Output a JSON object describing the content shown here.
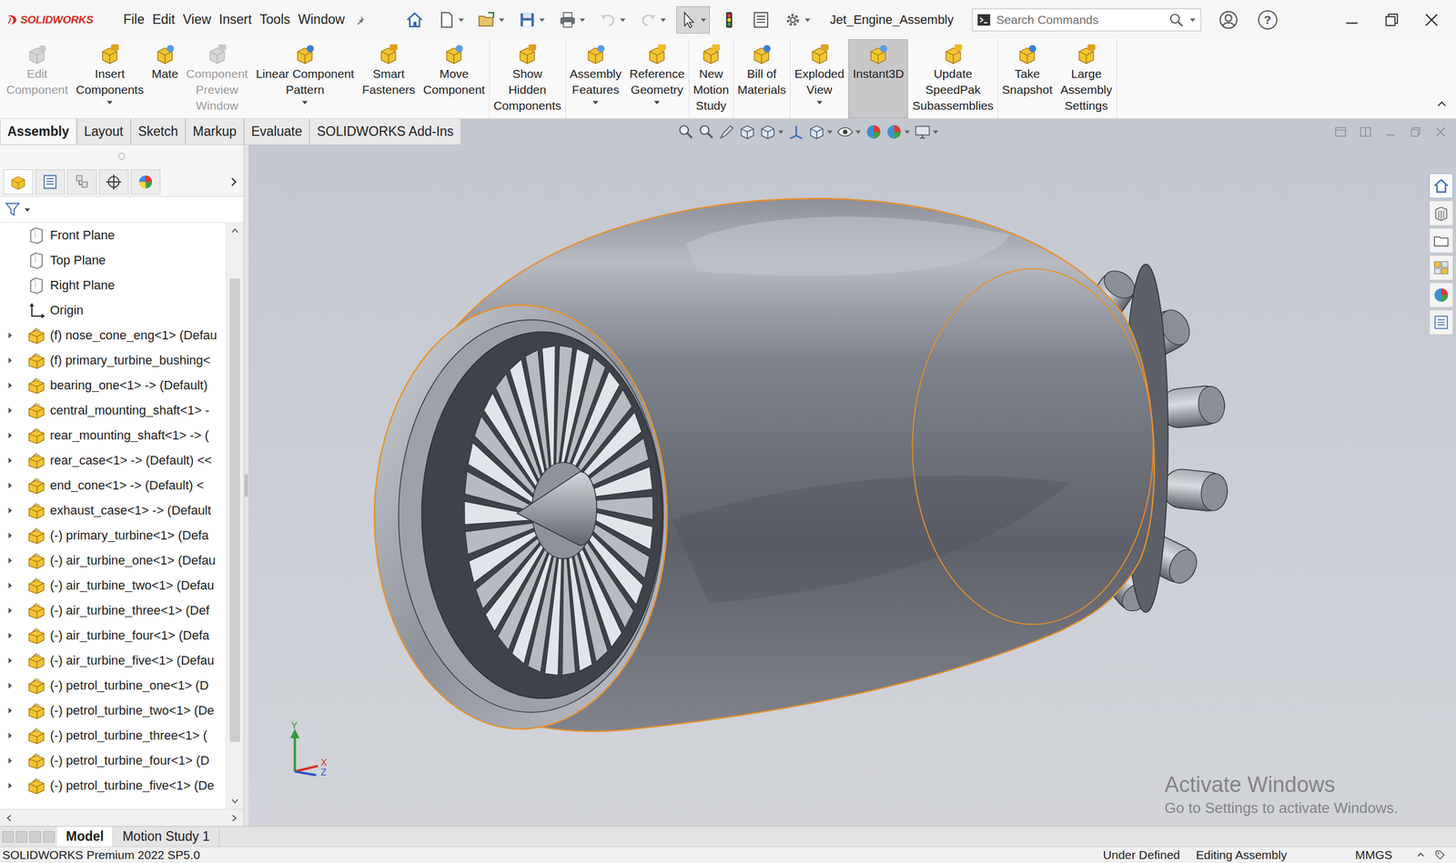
{
  "window": {
    "title": "Jet_Engine_Assembly"
  },
  "app": {
    "logo": "SOLIDWORKS"
  },
  "menu": [
    "File",
    "Edit",
    "View",
    "Insert",
    "Tools",
    "Window"
  ],
  "quick_access": [
    {
      "dropdown": false,
      "selected": false,
      "disabled": false
    },
    {
      "dropdown": true,
      "selected": false,
      "disabled": false
    },
    {
      "dropdown": true,
      "selected": false,
      "disabled": false
    },
    {
      "dropdown": true,
      "selected": false,
      "disabled": false
    },
    {
      "dropdown": true,
      "selected": false,
      "disabled": false
    },
    {
      "dropdown": true,
      "selected": false,
      "disabled": true
    },
    {
      "dropdown": true,
      "selected": false,
      "disabled": true
    },
    {
      "dropdown": true,
      "selected": true,
      "disabled": false
    },
    {
      "dropdown": false,
      "selected": false,
      "disabled": false
    },
    {
      "dropdown": false,
      "selected": false,
      "disabled": false
    },
    {
      "dropdown": true,
      "selected": false,
      "disabled": false
    }
  ],
  "search": {
    "placeholder": "Search Commands"
  },
  "help": "?",
  "ribbon": {
    "groups": [
      [
        {
          "lines": [
            "Edit",
            "Component"
          ],
          "disabled": true,
          "selected": false,
          "dropdown": false
        },
        {
          "lines": [
            "Insert",
            "Components"
          ],
          "disabled": false,
          "selected": false,
          "dropdown": true
        },
        {
          "lines": [
            "Mate"
          ],
          "disabled": false,
          "selected": false,
          "dropdown": false
        },
        {
          "lines": [
            "Component",
            "Preview",
            "Window"
          ],
          "disabled": true,
          "selected": false,
          "dropdown": false
        },
        {
          "lines": [
            "Linear Component",
            "Pattern"
          ],
          "disabled": false,
          "selected": false,
          "dropdown": true
        },
        {
          "lines": [
            "Smart",
            "Fasteners"
          ],
          "disabled": false,
          "selected": false,
          "dropdown": false
        },
        {
          "lines": [
            "Move",
            "Component"
          ],
          "disabled": false,
          "selected": false,
          "dropdown": false
        }
      ],
      [
        {
          "lines": [
            "Show",
            "Hidden",
            "Components"
          ],
          "disabled": false,
          "selected": false,
          "dropdown": false
        }
      ],
      [
        {
          "lines": [
            "Assembly",
            "Features"
          ],
          "disabled": false,
          "selected": false,
          "dropdown": true
        },
        {
          "lines": [
            "Reference",
            "Geometry"
          ],
          "disabled": false,
          "selected": false,
          "dropdown": true
        }
      ],
      [
        {
          "lines": [
            "New",
            "Motion",
            "Study"
          ],
          "disabled": false,
          "selected": false,
          "dropdown": false
        }
      ],
      [
        {
          "lines": [
            "Bill of",
            "Materials"
          ],
          "disabled": false,
          "selected": false,
          "dropdown": false
        }
      ],
      [
        {
          "lines": [
            "Exploded",
            "View"
          ],
          "disabled": false,
          "selected": false,
          "dropdown": true
        }
      ],
      [
        {
          "lines": [
            "Instant3D"
          ],
          "disabled": false,
          "selected": true,
          "dropdown": false
        }
      ],
      [
        {
          "lines": [
            "Update",
            "SpeedPak",
            "Subassemblies"
          ],
          "disabled": false,
          "selected": false,
          "dropdown": false
        }
      ],
      [
        {
          "lines": [
            "Take",
            "Snapshot"
          ],
          "disabled": false,
          "selected": false,
          "dropdown": false
        },
        {
          "lines": [
            "Large",
            "Assembly",
            "Settings"
          ],
          "disabled": false,
          "selected": false,
          "dropdown": false
        }
      ]
    ]
  },
  "tabs": [
    {
      "label": "Assembly",
      "selected": true
    },
    {
      "label": "Layout",
      "selected": false
    },
    {
      "label": "Sketch",
      "selected": false
    },
    {
      "label": "Markup",
      "selected": false
    },
    {
      "label": "Evaluate",
      "selected": false
    },
    {
      "label": "SOLIDWORKS Add-Ins",
      "selected": false
    }
  ],
  "tree": {
    "items": [
      {
        "label": "Front Plane",
        "kind": "plane",
        "expandable": false
      },
      {
        "label": "Top Plane",
        "kind": "plane",
        "expandable": false
      },
      {
        "label": "Right Plane",
        "kind": "plane",
        "expandable": false
      },
      {
        "label": "Origin",
        "kind": "origin",
        "expandable": false
      },
      {
        "label": "(f) nose_cone_eng<1> (Defau",
        "kind": "component",
        "expandable": true
      },
      {
        "label": "(f) primary_turbine_bushing<",
        "kind": "component",
        "expandable": true
      },
      {
        "label": "bearing_one<1> -> (Default)",
        "kind": "component",
        "expandable": true
      },
      {
        "label": "central_mounting_shaft<1> -",
        "kind": "component",
        "expandable": true
      },
      {
        "label": "rear_mounting_shaft<1> -> (",
        "kind": "component",
        "expandable": true
      },
      {
        "label": "rear_case<1> -> (Default) <<",
        "kind": "component",
        "expandable": true
      },
      {
        "label": "end_cone<1> -> (Default) <",
        "kind": "component",
        "expandable": true
      },
      {
        "label": "exhaust_case<1> -> (Default",
        "kind": "component",
        "expandable": true
      },
      {
        "label": "(-) primary_turbine<1> (Defa",
        "kind": "component",
        "expandable": true
      },
      {
        "label": "(-) air_turbine_one<1> (Defau",
        "kind": "component",
        "expandable": true
      },
      {
        "label": "(-) air_turbine_two<1> (Defau",
        "kind": "component",
        "expandable": true
      },
      {
        "label": "(-) air_turbine_three<1> (Def",
        "kind": "component",
        "expandable": true
      },
      {
        "label": "(-) air_turbine_four<1> (Defa",
        "kind": "component",
        "expandable": true
      },
      {
        "label": "(-) air_turbine_five<1> (Defau",
        "kind": "component",
        "expandable": true
      },
      {
        "label": "(-) petrol_turbine_one<1> (D",
        "kind": "component",
        "expandable": true
      },
      {
        "label": "(-) petrol_turbine_two<1> (De",
        "kind": "component",
        "expandable": true
      },
      {
        "label": "(-) petrol_turbine_three<1> (",
        "kind": "component",
        "expandable": true
      },
      {
        "label": "(-) petrol_turbine_four<1> (D",
        "kind": "component",
        "expandable": true
      },
      {
        "label": "(-) petrol_turbine_five<1> (De",
        "kind": "component",
        "expandable": true
      }
    ]
  },
  "triad": {
    "y": "Y",
    "x": "X",
    "z": "Z"
  },
  "watermark": {
    "title": "Activate Windows",
    "subtitle": "Go to Settings to activate Windows."
  },
  "bottom_tabs": [
    {
      "label": "Model",
      "selected": true
    },
    {
      "label": "Motion Study 1",
      "selected": false
    }
  ],
  "status_bar": {
    "product": "SOLIDWORKS Premium 2022 SP5.0",
    "state": "Under Defined",
    "mode": "Editing Assembly",
    "units": "MMGS"
  }
}
